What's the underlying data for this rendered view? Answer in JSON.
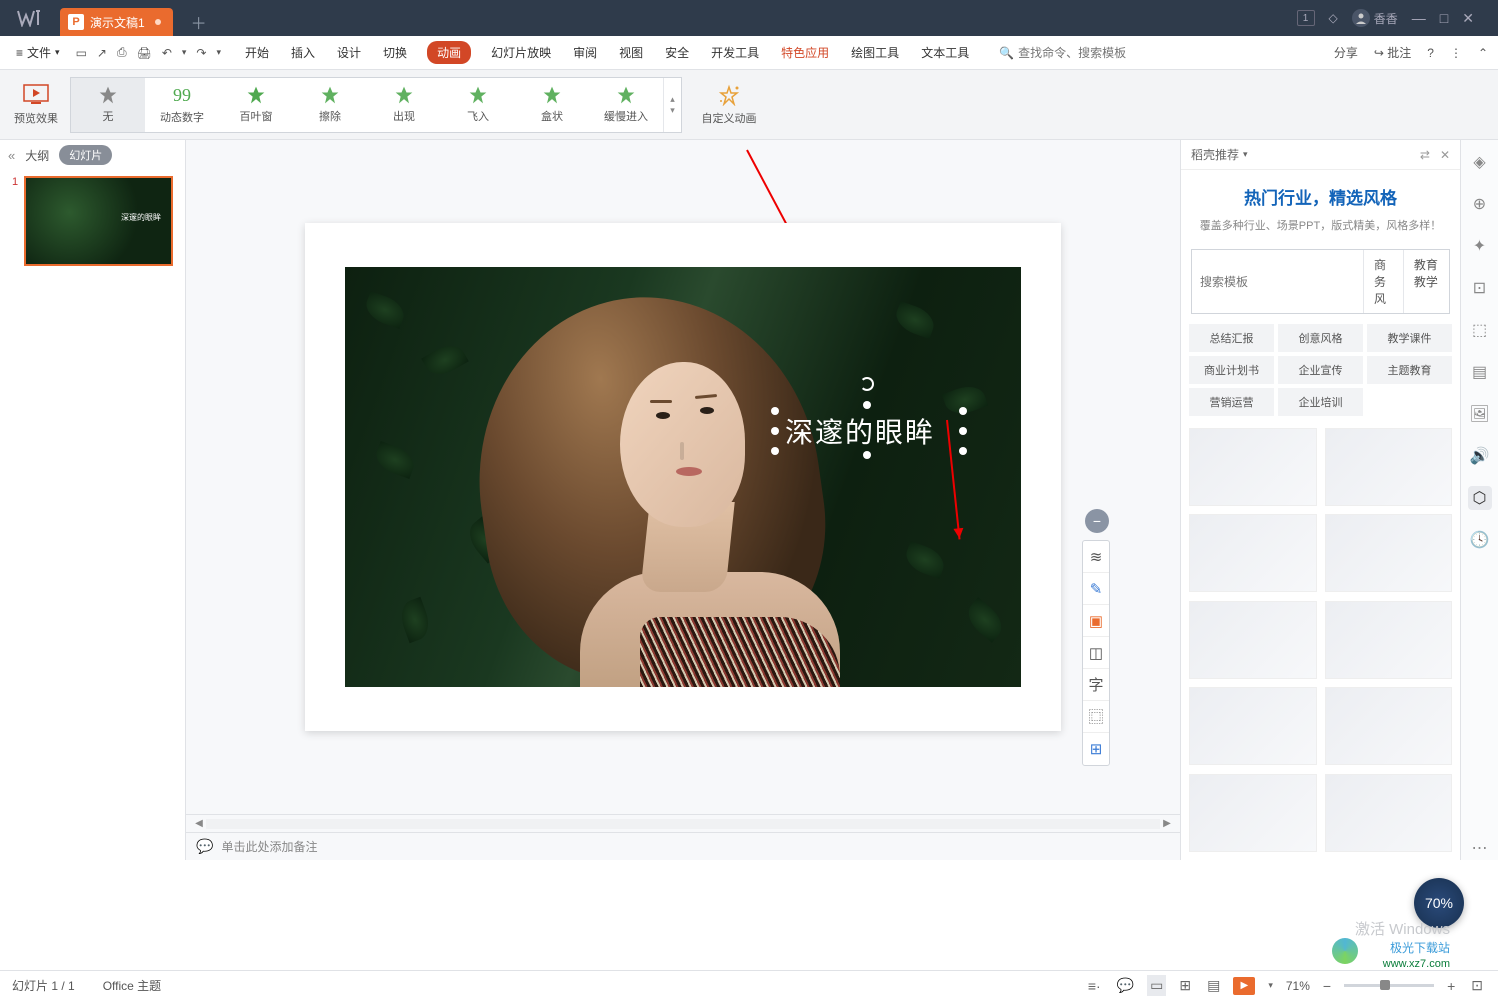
{
  "titlebar": {
    "app_name": "WPS",
    "active_tab": "演示文稿1",
    "badge": "1",
    "user_name": "香香"
  },
  "menubar": {
    "file": "文件",
    "tabs": [
      "开始",
      "插入",
      "设计",
      "切换",
      "动画",
      "幻灯片放映",
      "审阅",
      "视图",
      "安全",
      "开发工具",
      "特色应用",
      "绘图工具",
      "文本工具"
    ],
    "active_tab_index": 4,
    "hot_tab_index": 10,
    "search_placeholder": "查找命令、搜索模板",
    "share": "分享",
    "annotate": "批注"
  },
  "ribbon": {
    "preview": "预览效果",
    "animations": [
      "无",
      "动态数字",
      "百叶窗",
      "擦除",
      "出现",
      "飞入",
      "盒状",
      "缓慢进入"
    ],
    "selected_index": 0,
    "custom": "自定义动画"
  },
  "slidenav": {
    "outline": "大纲",
    "slides": "幻灯片",
    "slide_number": "1"
  },
  "slide": {
    "text": "深邃的眼眸"
  },
  "notes": {
    "placeholder": "单击此处添加备注"
  },
  "side_panel": {
    "title": "稻壳推荐",
    "hero_title": "热门行业，精选风格",
    "hero_sub": "覆盖多种行业、场景PPT，版式精美，风格多样！",
    "search_placeholder": "搜索模板",
    "search_btns": [
      "商务风",
      "教育教学"
    ],
    "tags": [
      "总结汇报",
      "创意风格",
      "教学课件",
      "商业计划书",
      "企业宣传",
      "主题教育",
      "营销运营",
      "企业培训"
    ]
  },
  "statusbar": {
    "slide_info": "幻灯片 1 / 1",
    "theme": "Office 主题",
    "zoom": "71%"
  },
  "watermark": {
    "windows": "激活 Windows",
    "site": "极光下载站",
    "url": "www.xz7.com"
  },
  "badge": "70%"
}
